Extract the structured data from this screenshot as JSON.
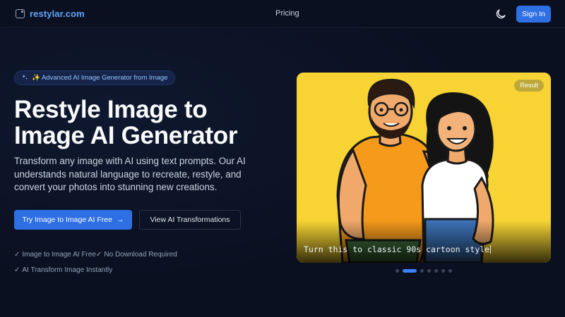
{
  "header": {
    "brand": "restylar.com",
    "nav": {
      "pricing": "Pricing"
    },
    "theme_icon": "moon-icon",
    "signin_label": "Sign In"
  },
  "hero": {
    "badge": {
      "icon": "sparkles-icon",
      "text": "✨ Advanced AI Image Generator from Image"
    },
    "headline_line1": "Restyle Image to",
    "headline_line2": "Image AI Generator",
    "subtitle": "Transform any image with AI using text prompts. Our AI understands natural language to recreate, restyle, and convert your photos into stunning new creations.",
    "primary_button": "Try Image to Image AI Free",
    "primary_button_arrow": "→",
    "secondary_button": "View AI Transformations",
    "features": [
      "Image to Image AI Free",
      "No Download Required",
      "AI Transform Image Instantly"
    ],
    "check_glyph": "✓"
  },
  "showcase": {
    "badge": "Result",
    "prompt": "Turn this to classic 90s cartoon style",
    "slide_count": 7,
    "active_slide": 2
  },
  "colors": {
    "accent": "#2f6fe4",
    "brand": "#60a5fa",
    "background": "#0b1020",
    "card_yellow": "#f7d433"
  }
}
